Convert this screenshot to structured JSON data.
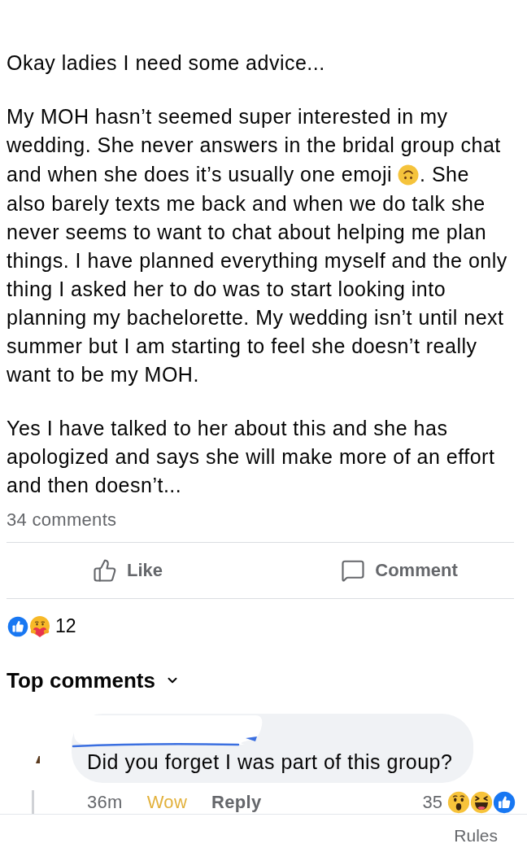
{
  "post": {
    "paragraphs": [
      {
        "blocks": [
          {
            "segments": [
              {
                "kind": "text",
                "text": "Okay ladies I need some advice..."
              }
            ]
          }
        ]
      },
      {
        "blocks": [
          {
            "segments": [
              {
                "kind": "text",
                "text": "My MOH hasn’t seemed super interested in my wedding. She never answers in the bridal group chat"
              }
            ]
          },
          {
            "segments": [
              {
                "kind": "text",
                "text": "and when she does it’s usually one emoji"
              },
              {
                "kind": "emoji"
              },
              {
                "kind": "text",
                "text": ". She"
              }
            ]
          },
          {
            "segments": [
              {
                "kind": "text",
                "text": "also barely texts me back and when we do talk she never seems to want to chat about helping me plan things. I have planned everything myself and the only thing I asked her to do was to start looking into planning my bachelorette. My wedding isn’t until next summer but I am starting to feel she doesn’t really want to be my MOH."
              }
            ]
          }
        ]
      },
      {
        "blocks": [
          {
            "segments": [
              {
                "kind": "text",
                "text": "Yes I have talked to her about this and she has apologized and says she will make more of an effort and then doesn’t..."
              }
            ]
          }
        ]
      }
    ],
    "comment_count": "34 comments"
  },
  "actions": [
    {
      "kind": "like",
      "label": "Like"
    },
    {
      "kind": "comment",
      "label": "Comment"
    }
  ],
  "reactions": {
    "icons": [
      {
        "kind": "like"
      },
      {
        "kind": "care"
      }
    ],
    "count": "12"
  },
  "comments_header": {
    "label": "Top comments"
  },
  "comments": [
    {
      "name_redacted": true,
      "text": "Did you forget I was part of this group?",
      "time": "36m",
      "react": {
        "label": "Wow",
        "selected": true
      },
      "reply": "Reply",
      "reactions": {
        "count": "35",
        "icons": [
          {
            "kind": "wow"
          },
          {
            "kind": "haha"
          },
          {
            "kind": "like"
          }
        ]
      }
    }
  ],
  "footer": {
    "link": "Rules"
  }
}
